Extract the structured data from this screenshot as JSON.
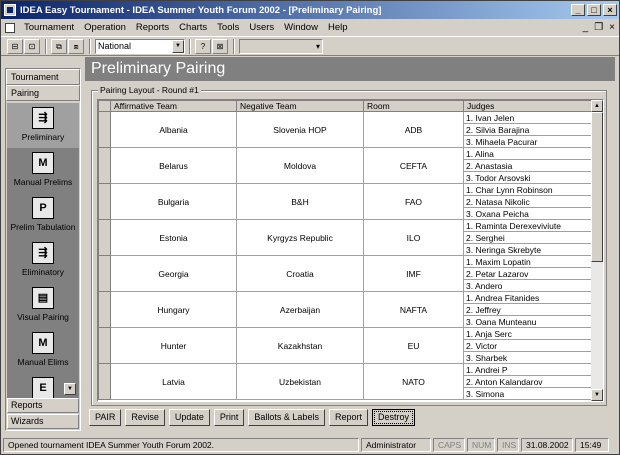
{
  "window": {
    "title": "IDEA Easy Tournament - IDEA Summer Youth Forum 2002 - [Preliminary Pairing]"
  },
  "menu": [
    "Tournament",
    "Operation",
    "Reports",
    "Charts",
    "Tools",
    "Users",
    "Window",
    "Help"
  ],
  "toolbar": {
    "combo_value": "National"
  },
  "sidebar": {
    "sections": {
      "tournament": "Tournament",
      "pairing": "Pairing",
      "reports": "Reports",
      "wizards": "Wizards"
    },
    "items": [
      {
        "label": "Preliminary",
        "icon": "preliminary-icon"
      },
      {
        "label": "Manual Prelims",
        "icon": "manual-prelims-icon"
      },
      {
        "label": "Prelim Tabulation",
        "icon": "prelim-tabulation-icon"
      },
      {
        "label": "Eliminatory",
        "icon": "eliminatory-icon"
      },
      {
        "label": "Visual Pairing",
        "icon": "visual-pairing-icon"
      },
      {
        "label": "Manual Elims",
        "icon": "manual-elims-icon"
      }
    ]
  },
  "page": {
    "heading": "Preliminary Pairing",
    "group_label": "Pairing Layout - Round #1"
  },
  "table": {
    "headers": [
      "Affirmative Team",
      "Negative Team",
      "Room",
      "Judges"
    ],
    "rows": [
      {
        "aff": "Albania",
        "neg": "Slovenia HOP",
        "room": "ADB",
        "judges": [
          "1. Ivan Jelen",
          "2. Silvia Barajina",
          "3. Mihaela Pacurar"
        ]
      },
      {
        "aff": "Belarus",
        "neg": "Moldova",
        "room": "CEFTA",
        "judges": [
          "1. Alina",
          "2. Anastasia",
          "3. Todor Arsovski"
        ]
      },
      {
        "aff": "Bulgaria",
        "neg": "B&H",
        "room": "FAO",
        "judges": [
          "1. Char Lynn Robinson",
          "2. Natasa Nikolic",
          "3. Oxana Peicha"
        ]
      },
      {
        "aff": "Estonia",
        "neg": "Kyrgyzs Republic",
        "room": "ILO",
        "judges": [
          "1. Raminta Derexeviviute",
          "2. Serghei",
          "3. Neringa Skrebyte"
        ]
      },
      {
        "aff": "Georgia",
        "neg": "Croatia",
        "room": "IMF",
        "judges": [
          "1. Maxim Lopatin",
          "2. Petar Lazarov",
          "3. Andero"
        ]
      },
      {
        "aff": "Hungary",
        "neg": "Azerbaijan",
        "room": "NAFTA",
        "judges": [
          "1. Andrea Fitanides",
          "2. Jeffrey",
          "3. Oana Munteanu"
        ]
      },
      {
        "aff": "Hunter",
        "neg": "Kazakhstan",
        "room": "EU",
        "judges": [
          "1. Anja Serc",
          "2. Victor",
          "3. Sharbek"
        ]
      },
      {
        "aff": "Latvia",
        "neg": "Uzbekistan",
        "room": "NATO",
        "judges": [
          "1. Andrei P",
          "2. Anton Kalandarov",
          "3. Simona"
        ]
      }
    ]
  },
  "buttons": [
    "PAIR",
    "Revise",
    "Update",
    "Print",
    "Ballots & Labels",
    "Report",
    "Destroy"
  ],
  "status": {
    "message": "Opened tournament IDEA Summer Youth Forum 2002.",
    "user": "Administrator",
    "caps": "CAPS",
    "num": "NUM",
    "ins": "INS",
    "date": "31.08.2002",
    "time": "15:49"
  }
}
